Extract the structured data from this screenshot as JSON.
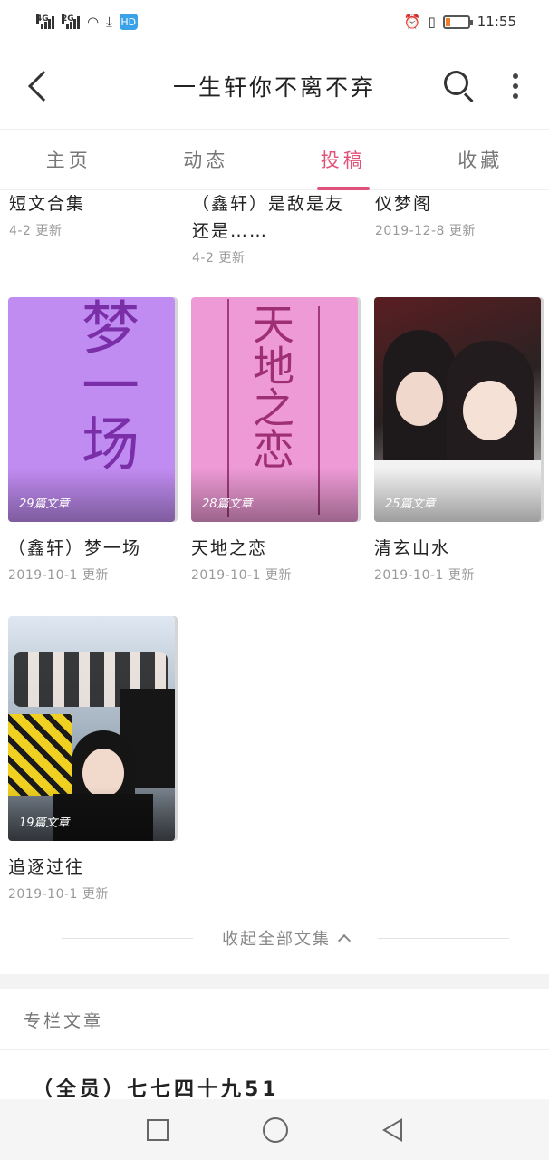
{
  "status_bar": {
    "signal1_label": "4G",
    "signal2_label": "2G",
    "hf_label": "HD",
    "time": "11:55",
    "battery_level": 0.2
  },
  "header": {
    "title": "一生轩你不离不弃",
    "icons": [
      "back-icon",
      "search-icon",
      "more-icon"
    ]
  },
  "tabs": [
    {
      "label": "主页",
      "active": false
    },
    {
      "label": "动态",
      "active": false
    },
    {
      "label": "投稿",
      "active": true
    },
    {
      "label": "收藏",
      "active": false
    }
  ],
  "top_row": [
    {
      "title": "短文合集",
      "date": "4-2 更新"
    },
    {
      "title": "（鑫轩）是敌是友还是……",
      "date": "4-2 更新"
    },
    {
      "title": "仪梦阁",
      "date": "2019-12-8 更新"
    }
  ],
  "collections": [
    {
      "title": "（鑫轩）梦一场",
      "date": "2019-10-1 更新",
      "count": "29篇文章",
      "cover_text": "梦一场",
      "cover_color": "#c18cf2"
    },
    {
      "title": "天地之恋",
      "date": "2019-10-1 更新",
      "count": "28篇文章",
      "cover_text": "天地之恋",
      "cover_color": "#ee9ad6"
    },
    {
      "title": "清玄山水",
      "date": "2019-10-1 更新",
      "count": "25篇文章",
      "cover_text": "",
      "cover_color": "#3a2a2c"
    },
    {
      "title": "追逐过往",
      "date": "2019-10-1 更新",
      "count": "19篇文章",
      "cover_text": "",
      "cover_color": "#7f8a96"
    }
  ],
  "collapse": {
    "label": "收起全部文集"
  },
  "column_section": {
    "title": "专栏文章",
    "first_article": "（全员）七七四十九51"
  },
  "colors": {
    "accent": "#e0527a"
  }
}
